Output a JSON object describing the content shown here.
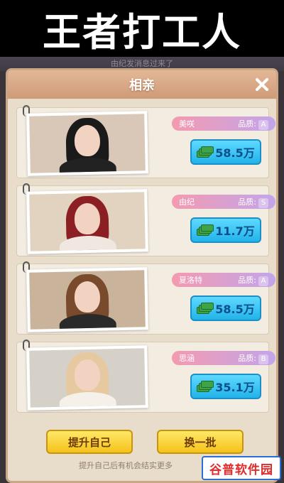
{
  "banner": {
    "title": "王者打工人"
  },
  "background": {
    "notice": "由纪发消息过来了"
  },
  "dialog": {
    "title": "相亲",
    "candidates": [
      {
        "name": "美咲",
        "grade_label": "品质:",
        "grade": "A",
        "price": "58.5万",
        "hair_color": "#1a1a1a",
        "bg_color": "#d9c8b8",
        "outfit_color": "#222"
      },
      {
        "name": "由纪",
        "grade_label": "品质:",
        "grade": "S",
        "price": "11.7万",
        "hair_color": "#8b1f24",
        "bg_color": "#e2d2c0",
        "outfit_color": "#f0e8e0"
      },
      {
        "name": "夏洛特",
        "grade_label": "品质:",
        "grade": "A",
        "price": "58.5万",
        "hair_color": "#7a4a2c",
        "bg_color": "#c9b39a",
        "outfit_color": "#2a2a2a"
      },
      {
        "name": "思涵",
        "grade_label": "品质:",
        "grade": "B",
        "price": "35.1万",
        "hair_color": "#e6c9a0",
        "bg_color": "#d5d0c8",
        "outfit_color": "#f5f0ea"
      }
    ],
    "buttons": {
      "improve_label": "提升自己",
      "refresh_label": "换一批"
    },
    "hint": "提升自己后有机会结实更多"
  },
  "watermark": {
    "text": "谷普软件园"
  }
}
